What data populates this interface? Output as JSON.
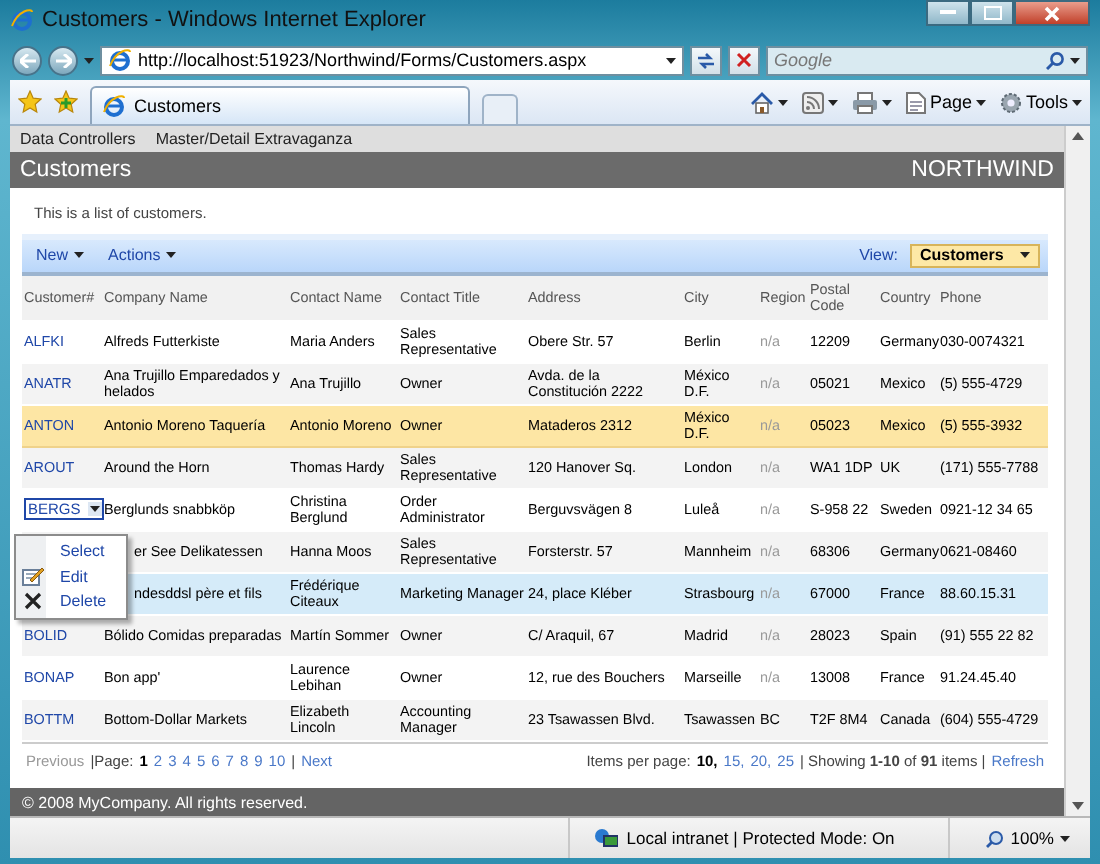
{
  "window": {
    "title": "Customers - Windows Internet Explorer"
  },
  "address_bar": {
    "url": "http://localhost:51923/Northwind/Forms/Customers.aspx"
  },
  "search": {
    "placeholder": "Google"
  },
  "tabs": [
    {
      "label": "Customers",
      "selected": true
    }
  ],
  "commands": [
    {
      "kind": "home"
    },
    {
      "kind": "feeds"
    },
    {
      "kind": "print"
    },
    {
      "kind": "page",
      "label": "Page"
    },
    {
      "kind": "tools",
      "label": "Tools"
    }
  ],
  "site_menu": [
    "Data Controllers",
    "Master/Detail Extravaganza"
  ],
  "header": {
    "title": "Customers",
    "brand": "NORTHWIND"
  },
  "description": "This is a list of customers.",
  "toolbar": {
    "actions": [
      "New",
      "Actions"
    ],
    "view_label": "View:",
    "view_value": "Customers"
  },
  "table": {
    "columns": [
      "Customer#",
      "Company Name",
      "Contact Name",
      "Contact Title",
      "Address",
      "City",
      "Region",
      "Postal Code",
      "Country",
      "Phone"
    ],
    "rows": [
      {
        "id": "ALFKI",
        "company": "Alfreds Futterkiste",
        "contact": "Maria Anders",
        "title": "Sales Representative",
        "address": "Obere Str. 57",
        "city": "Berlin",
        "region": "n/a",
        "region_empty": true,
        "postal": "12209",
        "country": "Germany",
        "phone": "030-0074321",
        "selected": false,
        "hovered": false,
        "menu_open": false
      },
      {
        "id": "ANATR",
        "company": "Ana Trujillo Emparedados y helados",
        "contact": "Ana Trujillo",
        "title": "Owner",
        "address": "Avda. de la Constitución 2222",
        "city": "México D.F.",
        "region": "n/a",
        "region_empty": true,
        "postal": "05021",
        "country": "Mexico",
        "phone": "(5) 555-4729",
        "selected": false,
        "hovered": false,
        "menu_open": false
      },
      {
        "id": "ANTON",
        "company": "Antonio Moreno Taquería",
        "contact": "Antonio Moreno",
        "title": "Owner",
        "address": "Mataderos 2312",
        "city": "México D.F.",
        "region": "n/a",
        "region_empty": true,
        "postal": "05023",
        "country": "Mexico",
        "phone": "(5) 555-3932",
        "selected": true,
        "hovered": false,
        "menu_open": false
      },
      {
        "id": "AROUT",
        "company": "Around the Horn",
        "contact": "Thomas Hardy",
        "title": "Sales Representative",
        "address": "120 Hanover Sq.",
        "city": "London",
        "region": "n/a",
        "region_empty": true,
        "postal": "WA1 1DP",
        "country": "UK",
        "phone": "(171) 555-7788",
        "selected": false,
        "hovered": false,
        "menu_open": false
      },
      {
        "id": "BERGS",
        "company": "Berglunds snabbköp",
        "contact": "Christina Berglund",
        "title": "Order Administrator",
        "address": "Berguvsvägen 8",
        "city": "Luleå",
        "region": "n/a",
        "region_empty": true,
        "postal": "S-958 22",
        "country": "Sweden",
        "phone": "0921-12 34 65",
        "selected": false,
        "hovered": false,
        "menu_open": true
      },
      {
        "company": "er See Delikatessen",
        "contact": "Hanna Moos",
        "title": "Sales Representative",
        "address": "Forsterstr. 57",
        "city": "Mannheim",
        "region": "n/a",
        "region_empty": true,
        "postal": "68306",
        "country": "Germany",
        "phone": "0621-08460",
        "selected": false,
        "hovered": false,
        "menu_open": false
      },
      {
        "company": "ndesddsl père et fils",
        "contact": "Frédérique Citeaux",
        "title": "Marketing Manager",
        "address": "24, place Kléber",
        "city": "Strasbourg",
        "region": "n/a",
        "region_empty": true,
        "postal": "67000",
        "country": "France",
        "phone": "88.60.15.31",
        "selected": false,
        "hovered": true,
        "menu_open": false
      },
      {
        "id": "BOLID",
        "company": "Bólido Comidas preparadas",
        "contact": "Martín Sommer",
        "title": "Owner",
        "address": "C/ Araquil, 67",
        "city": "Madrid",
        "region": "n/a",
        "region_empty": true,
        "postal": "28023",
        "country": "Spain",
        "phone": "(91) 555 22 82",
        "selected": false,
        "hovered": false,
        "menu_open": false
      },
      {
        "id": "BONAP",
        "company": "Bon app'",
        "contact": "Laurence Lebihan",
        "title": "Owner",
        "address": "12, rue des Bouchers",
        "city": "Marseille",
        "region": "n/a",
        "region_empty": true,
        "postal": "13008",
        "country": "France",
        "phone": "91.24.45.40",
        "selected": false,
        "hovered": false,
        "menu_open": false
      },
      {
        "id": "BOTTM",
        "company": "Bottom-Dollar Markets",
        "contact": "Elizabeth Lincoln",
        "title": "Accounting Manager",
        "address": "23 Tsawassen Blvd.",
        "city": "Tsawassen",
        "region": "BC",
        "region_empty": false,
        "postal": "T2F 8M4",
        "country": "Canada",
        "phone": "(604) 555-4729",
        "selected": false,
        "hovered": false,
        "menu_open": false
      }
    ]
  },
  "context_menu": [
    {
      "label": "Select",
      "kind": "plain"
    },
    {
      "label": "Edit",
      "kind": "edit"
    },
    {
      "label": "Delete",
      "kind": "delete"
    }
  ],
  "pager": {
    "previous": "Previous",
    "previous_disabled": true,
    "page_label": "|Page:",
    "pages": [
      {
        "label": "1",
        "selected": true
      },
      {
        "label": "2",
        "selected": false
      },
      {
        "label": "3",
        "selected": false
      },
      {
        "label": "4",
        "selected": false
      },
      {
        "label": "5",
        "selected": false
      },
      {
        "label": "6",
        "selected": false
      },
      {
        "label": "7",
        "selected": false
      },
      {
        "label": "8",
        "selected": false
      },
      {
        "label": "9",
        "selected": false
      },
      {
        "label": "10",
        "selected": false
      }
    ],
    "separator": "|",
    "next": "Next",
    "items_label": "Items per page:",
    "sizes": [
      {
        "label": "10,",
        "selected": true
      },
      {
        "label": "15,",
        "selected": false
      },
      {
        "label": "20,",
        "selected": false
      },
      {
        "label": "25",
        "selected": false
      }
    ],
    "showing": "| Showing **1-10** of **91** items |",
    "refresh": "Refresh"
  },
  "footer": "© 2008 MyCompany. All rights reserved.",
  "status_bar": {
    "zone": "Local intranet | Protected Mode: On",
    "zoom": "100%"
  }
}
